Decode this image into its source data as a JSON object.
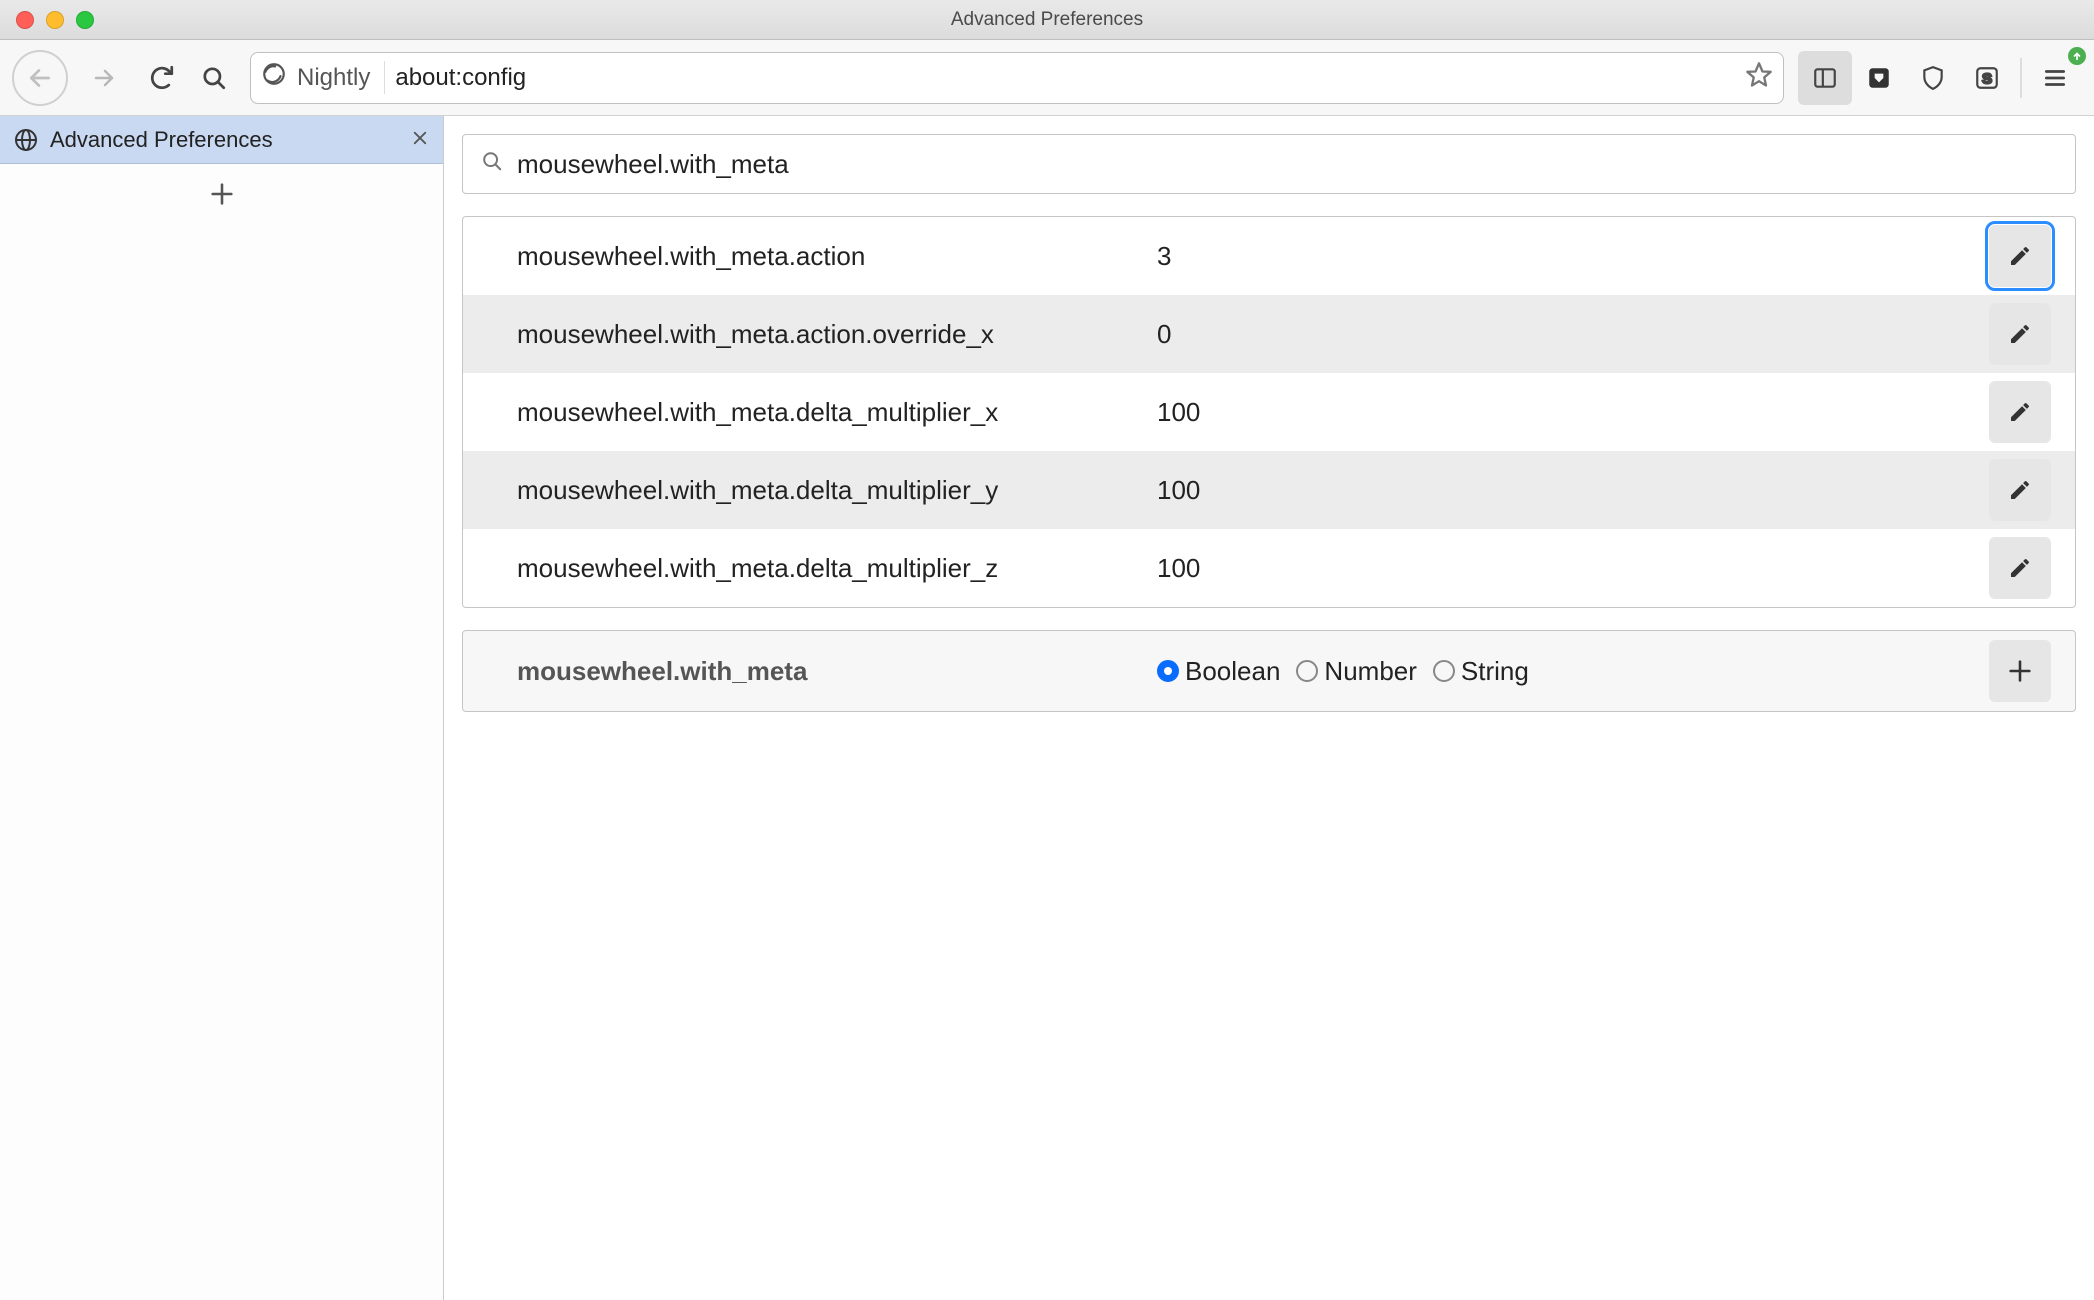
{
  "window": {
    "title": "Advanced Preferences"
  },
  "urlbar": {
    "identity_label": "Nightly",
    "path": "about:config"
  },
  "sidebar": {
    "tab_label": "Advanced Preferences"
  },
  "content": {
    "search_value": "mousewheel.with_meta",
    "prefs": [
      {
        "name": "mousewheel.with_meta.action",
        "value": "3",
        "focused": true
      },
      {
        "name": "mousewheel.with_meta.action.override_x",
        "value": "0",
        "focused": false
      },
      {
        "name": "mousewheel.with_meta.delta_multiplier_x",
        "value": "100",
        "focused": false
      },
      {
        "name": "mousewheel.with_meta.delta_multiplier_y",
        "value": "100",
        "focused": false
      },
      {
        "name": "mousewheel.with_meta.delta_multiplier_z",
        "value": "100",
        "focused": false
      }
    ],
    "newpref": {
      "name": "mousewheel.with_meta",
      "types": [
        {
          "label": "Boolean",
          "selected": true
        },
        {
          "label": "Number",
          "selected": false
        },
        {
          "label": "String",
          "selected": false
        }
      ]
    }
  }
}
